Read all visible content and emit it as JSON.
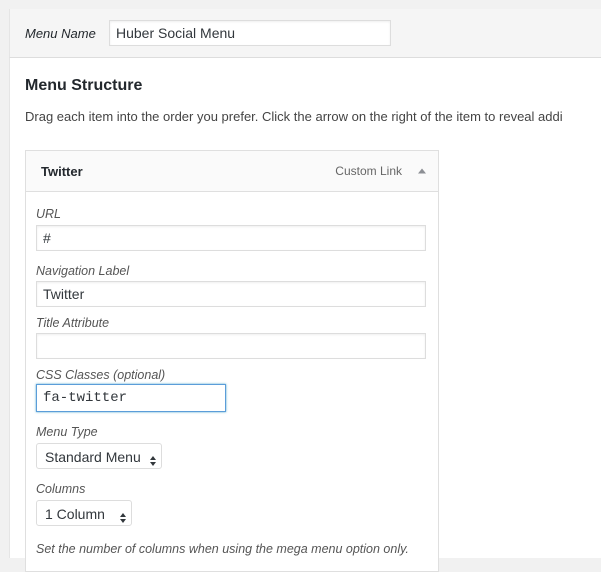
{
  "menu_name": {
    "label": "Menu Name",
    "value": "Huber Social Menu"
  },
  "structure": {
    "title": "Menu Structure",
    "description": "Drag each item into the order you prefer. Click the arrow on the right of the item to reveal addi"
  },
  "item": {
    "title": "Twitter",
    "type": "Custom Link",
    "toggle_icon": "arrow-up-icon",
    "url_label": "URL",
    "url_value": "#",
    "nav_label": "Navigation Label",
    "nav_value": "Twitter",
    "title_attr_label": "Title Attribute",
    "title_attr_value": "",
    "css_label": "CSS Classes (optional)",
    "css_value": "fa-twitter",
    "menu_type_label": "Menu Type",
    "menu_type_value": "Standard Menu",
    "columns_label": "Columns",
    "columns_value": "1 Column",
    "columns_help": "Set the number of columns when using the mega menu option only."
  },
  "colors": {
    "focus_border": "#5b9dd9",
    "panel_bg": "#ffffff",
    "page_bg": "#f1f1f1"
  }
}
